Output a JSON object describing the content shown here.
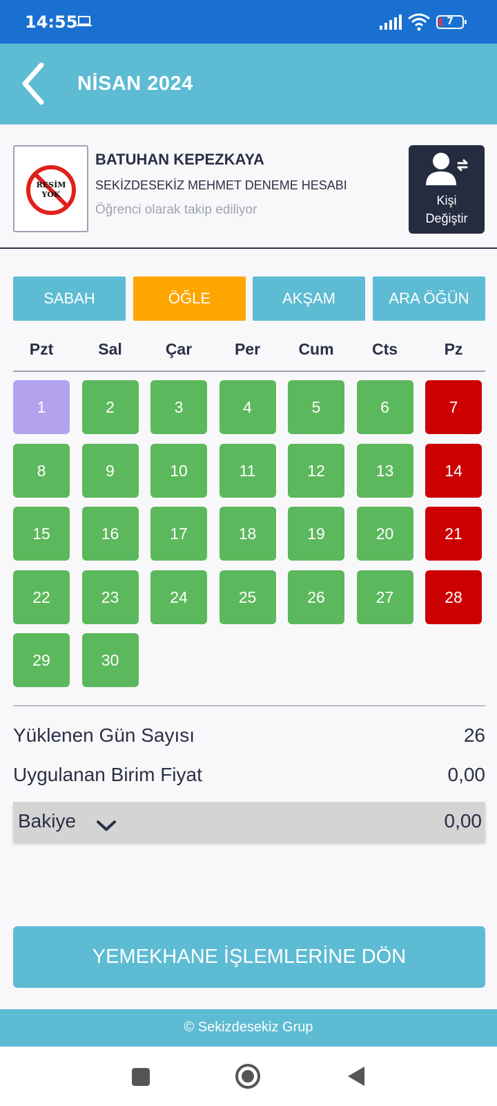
{
  "status_bar": {
    "time": "14:55",
    "battery_level": "7"
  },
  "header": {
    "title": "NİSAN 2024"
  },
  "profile": {
    "avatar_text": "RESİM YOK",
    "name": "BATUHAN KEPEZKAYA",
    "organization": "SEKİZDESEKİZ MEHMET DENEME HESABI",
    "status": "Öğrenci olarak takip ediliyor",
    "change_person_label": "Kişi\nDeğiştir"
  },
  "meal_tabs": [
    {
      "label": "SABAH",
      "active": false
    },
    {
      "label": "ÖĞLE",
      "active": true
    },
    {
      "label": "AKŞAM",
      "active": false
    },
    {
      "label": "ARA ÖĞÜN",
      "active": false
    }
  ],
  "weekdays": [
    "Pzt",
    "Sal",
    "Çar",
    "Per",
    "Cum",
    "Cts",
    "Pz"
  ],
  "colors": {
    "loaded": "#5cb85c",
    "weekend": "#cc0000",
    "today": "#b3a3ee",
    "accent": "#5dbbd3",
    "active_tab": "#ffa500"
  },
  "calendar": {
    "first_weekday_index": 0,
    "days": [
      {
        "day": "1",
        "status": "today"
      },
      {
        "day": "2",
        "status": "loaded"
      },
      {
        "day": "3",
        "status": "loaded"
      },
      {
        "day": "4",
        "status": "loaded"
      },
      {
        "day": "5",
        "status": "loaded"
      },
      {
        "day": "6",
        "status": "loaded"
      },
      {
        "day": "7",
        "status": "weekend"
      },
      {
        "day": "8",
        "status": "loaded"
      },
      {
        "day": "9",
        "status": "loaded"
      },
      {
        "day": "10",
        "status": "loaded"
      },
      {
        "day": "11",
        "status": "loaded"
      },
      {
        "day": "12",
        "status": "loaded"
      },
      {
        "day": "13",
        "status": "loaded"
      },
      {
        "day": "14",
        "status": "weekend"
      },
      {
        "day": "15",
        "status": "loaded"
      },
      {
        "day": "16",
        "status": "loaded"
      },
      {
        "day": "17",
        "status": "loaded"
      },
      {
        "day": "18",
        "status": "loaded"
      },
      {
        "day": "19",
        "status": "loaded"
      },
      {
        "day": "20",
        "status": "loaded"
      },
      {
        "day": "21",
        "status": "weekend"
      },
      {
        "day": "22",
        "status": "loaded"
      },
      {
        "day": "23",
        "status": "loaded"
      },
      {
        "day": "24",
        "status": "loaded"
      },
      {
        "day": "25",
        "status": "loaded"
      },
      {
        "day": "26",
        "status": "loaded"
      },
      {
        "day": "27",
        "status": "loaded"
      },
      {
        "day": "28",
        "status": "weekend"
      },
      {
        "day": "29",
        "status": "loaded"
      },
      {
        "day": "30",
        "status": "loaded"
      }
    ]
  },
  "summary": {
    "loaded_days_label": "Yüklenen Gün Sayısı",
    "loaded_days_value": "26",
    "unit_price_label": "Uygulanan Birim Fiyat",
    "unit_price_value": "0,00",
    "balance_label": "Bakiye",
    "balance_value": "0,00"
  },
  "actions": {
    "return_label": "YEMEKHANE İŞLEMLERİNE DÖN"
  },
  "footer": {
    "text": "© Sekizdesekiz Grup"
  },
  "icons": {
    "back": "chevron-left-icon",
    "change_person": "person-swap-icon",
    "balance_toggle": "chevron-down-icon"
  }
}
